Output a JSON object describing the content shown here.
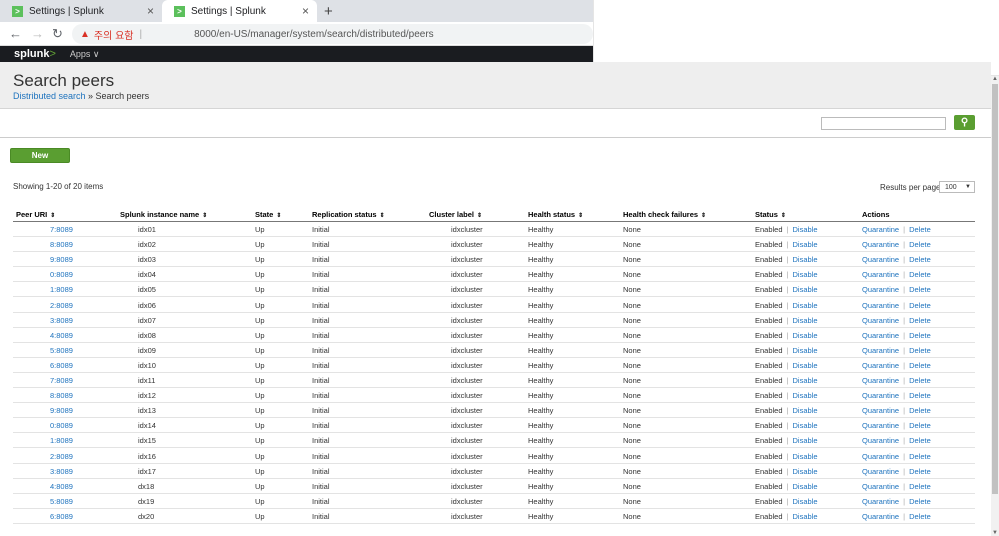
{
  "browser": {
    "tabs": [
      {
        "title": "Settings | Splunk",
        "favicon": ">"
      },
      {
        "title": "Settings | Splunk",
        "favicon": ">"
      }
    ],
    "new_tab": "+",
    "warning_text": "주의 요함",
    "url": "8000/en-US/manager/system/search/distributed/peers"
  },
  "splunkbar": {
    "logo": "splunk",
    "logo_mark": ">",
    "apps_label": "Apps ∨"
  },
  "header": {
    "title": "Search peers",
    "breadcrumb_link": "Distributed search",
    "breadcrumb_current": " » Search peers"
  },
  "toolbar": {
    "new_label": "New",
    "search_glyph": "🔍"
  },
  "list": {
    "showing_text": "Showing 1-20 of 20 items",
    "results_per_page_label": "Results per page",
    "results_per_page_value": "100"
  },
  "columns": [
    "Peer URI",
    "Splunk instance name",
    "State",
    "Replication status",
    "Cluster label",
    "Health status",
    "Health check failures",
    "Status",
    "Actions"
  ],
  "rows": [
    {
      "uri": "7:8089",
      "name": "idx01",
      "state": "Up",
      "replication": "Initial",
      "cluster": "idxcluster",
      "health": "Healthy",
      "failures": "None",
      "status": "Enabled",
      "disable": "Disable",
      "quarantine": "Quarantine",
      "delete": "Delete"
    },
    {
      "uri": "8:8089",
      "name": "idx02",
      "state": "Up",
      "replication": "Initial",
      "cluster": "idxcluster",
      "health": "Healthy",
      "failures": "None",
      "status": "Enabled",
      "disable": "Disable",
      "quarantine": "Quarantine",
      "delete": "Delete"
    },
    {
      "uri": "9:8089",
      "name": "idx03",
      "state": "Up",
      "replication": "Initial",
      "cluster": "idxcluster",
      "health": "Healthy",
      "failures": "None",
      "status": "Enabled",
      "disable": "Disable",
      "quarantine": "Quarantine",
      "delete": "Delete"
    },
    {
      "uri": "0:8089",
      "name": "idx04",
      "state": "Up",
      "replication": "Initial",
      "cluster": "idxcluster",
      "health": "Healthy",
      "failures": "None",
      "status": "Enabled",
      "disable": "Disable",
      "quarantine": "Quarantine",
      "delete": "Delete"
    },
    {
      "uri": "1:8089",
      "name": "idx05",
      "state": "Up",
      "replication": "Initial",
      "cluster": "idxcluster",
      "health": "Healthy",
      "failures": "None",
      "status": "Enabled",
      "disable": "Disable",
      "quarantine": "Quarantine",
      "delete": "Delete"
    },
    {
      "uri": "2:8089",
      "name": "idx06",
      "state": "Up",
      "replication": "Initial",
      "cluster": "idxcluster",
      "health": "Healthy",
      "failures": "None",
      "status": "Enabled",
      "disable": "Disable",
      "quarantine": "Quarantine",
      "delete": "Delete"
    },
    {
      "uri": "3:8089",
      "name": "idx07",
      "state": "Up",
      "replication": "Initial",
      "cluster": "idxcluster",
      "health": "Healthy",
      "failures": "None",
      "status": "Enabled",
      "disable": "Disable",
      "quarantine": "Quarantine",
      "delete": "Delete"
    },
    {
      "uri": "4:8089",
      "name": "idx08",
      "state": "Up",
      "replication": "Initial",
      "cluster": "idxcluster",
      "health": "Healthy",
      "failures": "None",
      "status": "Enabled",
      "disable": "Disable",
      "quarantine": "Quarantine",
      "delete": "Delete"
    },
    {
      "uri": "5:8089",
      "name": "idx09",
      "state": "Up",
      "replication": "Initial",
      "cluster": "idxcluster",
      "health": "Healthy",
      "failures": "None",
      "status": "Enabled",
      "disable": "Disable",
      "quarantine": "Quarantine",
      "delete": "Delete"
    },
    {
      "uri": "6:8089",
      "name": "idx10",
      "state": "Up",
      "replication": "Initial",
      "cluster": "idxcluster",
      "health": "Healthy",
      "failures": "None",
      "status": "Enabled",
      "disable": "Disable",
      "quarantine": "Quarantine",
      "delete": "Delete"
    },
    {
      "uri": "7:8089",
      "name": "idx11",
      "state": "Up",
      "replication": "Initial",
      "cluster": "idxcluster",
      "health": "Healthy",
      "failures": "None",
      "status": "Enabled",
      "disable": "Disable",
      "quarantine": "Quarantine",
      "delete": "Delete"
    },
    {
      "uri": "8:8089",
      "name": "idx12",
      "state": "Up",
      "replication": "Initial",
      "cluster": "idxcluster",
      "health": "Healthy",
      "failures": "None",
      "status": "Enabled",
      "disable": "Disable",
      "quarantine": "Quarantine",
      "delete": "Delete"
    },
    {
      "uri": "9:8089",
      "name": "idx13",
      "state": "Up",
      "replication": "Initial",
      "cluster": "idxcluster",
      "health": "Healthy",
      "failures": "None",
      "status": "Enabled",
      "disable": "Disable",
      "quarantine": "Quarantine",
      "delete": "Delete"
    },
    {
      "uri": "0:8089",
      "name": "idx14",
      "state": "Up",
      "replication": "Initial",
      "cluster": "idxcluster",
      "health": "Healthy",
      "failures": "None",
      "status": "Enabled",
      "disable": "Disable",
      "quarantine": "Quarantine",
      "delete": "Delete"
    },
    {
      "uri": "1:8089",
      "name": "idx15",
      "state": "Up",
      "replication": "Initial",
      "cluster": "idxcluster",
      "health": "Healthy",
      "failures": "None",
      "status": "Enabled",
      "disable": "Disable",
      "quarantine": "Quarantine",
      "delete": "Delete"
    },
    {
      "uri": "2:8089",
      "name": "idx16",
      "state": "Up",
      "replication": "Initial",
      "cluster": "idxcluster",
      "health": "Healthy",
      "failures": "None",
      "status": "Enabled",
      "disable": "Disable",
      "quarantine": "Quarantine",
      "delete": "Delete"
    },
    {
      "uri": "3:8089",
      "name": "idx17",
      "state": "Up",
      "replication": "Initial",
      "cluster": "idxcluster",
      "health": "Healthy",
      "failures": "None",
      "status": "Enabled",
      "disable": "Disable",
      "quarantine": "Quarantine",
      "delete": "Delete"
    },
    {
      "uri": "4:8089",
      "name": "dx18",
      "state": "Up",
      "replication": "Initial",
      "cluster": "idxcluster",
      "health": "Healthy",
      "failures": "None",
      "status": "Enabled",
      "disable": "Disable",
      "quarantine": "Quarantine",
      "delete": "Delete"
    },
    {
      "uri": "5:8089",
      "name": "dx19",
      "state": "Up",
      "replication": "Initial",
      "cluster": "idxcluster",
      "health": "Healthy",
      "failures": "None",
      "status": "Enabled",
      "disable": "Disable",
      "quarantine": "Quarantine",
      "delete": "Delete"
    },
    {
      "uri": "6:8089",
      "name": "dx20",
      "state": "Up",
      "replication": "Initial",
      "cluster": "idxcluster",
      "health": "Healthy",
      "failures": "None",
      "status": "Enabled",
      "disable": "Disable",
      "quarantine": "Quarantine",
      "delete": "Delete"
    }
  ],
  "colors": {
    "link": "#1e73be",
    "accent_green": "#5a9e31",
    "splunkbar": "#1a1c20"
  }
}
